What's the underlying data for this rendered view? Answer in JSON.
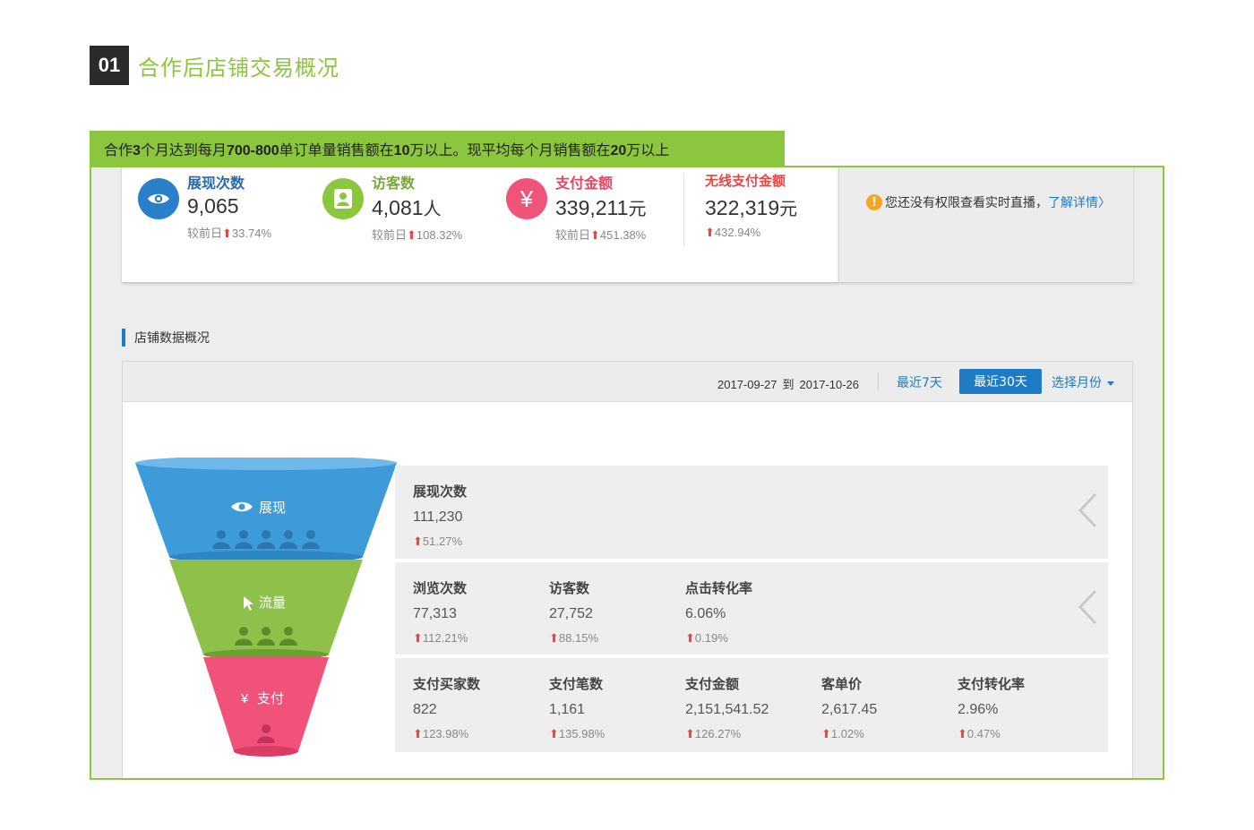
{
  "section": {
    "number": "01",
    "title": "合作后店铺交易概况"
  },
  "banner": {
    "parts": [
      {
        "text": "合作",
        "bold": false
      },
      {
        "text": "3",
        "bold": true
      },
      {
        "text": "个月达到每月",
        "bold": false
      },
      {
        "text": "700-800",
        "bold": true
      },
      {
        "text": "单订单量销售额在",
        "bold": false
      },
      {
        "text": "10",
        "bold": true
      },
      {
        "text": "万以上。现平均每个月销售额在",
        "bold": false
      },
      {
        "text": "20",
        "bold": true
      },
      {
        "text": "万以上",
        "bold": false
      }
    ]
  },
  "colors": {
    "accent_green": "#8cc63f",
    "brand_blue": "#1f7bc4",
    "up_red": "#e84545",
    "visitor_green": "#8cc63f",
    "payment_pink": "#f0547a"
  },
  "stats": [
    {
      "label": "展现次数",
      "value": "9,065",
      "unit": "",
      "compare": "较前日",
      "arrow": "⬆",
      "pct": "33.74%",
      "icon": "eye-icon",
      "color": "#2a7fc9"
    },
    {
      "label": "访客数",
      "value": "4,081",
      "unit": "人",
      "compare": "较前日",
      "arrow": "⬆",
      "pct": "108.32%",
      "icon": "user-icon",
      "color": "#8cc63f"
    },
    {
      "label": "支付金额",
      "value": "339,211",
      "unit": "元",
      "compare": "较前日",
      "arrow": "⬆",
      "pct": "451.38%",
      "icon": "yen-icon",
      "color": "#f0547a"
    },
    {
      "label": "无线支付金额",
      "value": "322,319",
      "unit": "元",
      "compare": "",
      "arrow": "⬆",
      "pct": "432.94%",
      "icon": "",
      "color": "#e84545"
    }
  ],
  "notice": {
    "icon": "!",
    "text": "您还没有权限查看实时直播，",
    "link": "了解详情"
  },
  "overview": {
    "title": "店铺数据概况",
    "date_from": "2017-09-27",
    "date_sep": "到",
    "date_to": "2017-10-26",
    "btn_7": "最近7天",
    "btn_30": "最近30天",
    "btn_month": "选择月份"
  },
  "funnel": {
    "stages": [
      {
        "label": "展现",
        "icon": "eye-icon",
        "color": "#3d9bd9",
        "people": 5
      },
      {
        "label": "流量",
        "icon": "cursor-icon",
        "color": "#8fc04a",
        "people": 3
      },
      {
        "label": "支付",
        "icon": "yen-icon",
        "color": "#f0527c",
        "people": 1
      }
    ]
  },
  "rows": [
    {
      "metrics": [
        {
          "label": "展现次数",
          "value": "111,230",
          "arrow": "⬆",
          "pct": "51.27%"
        }
      ]
    },
    {
      "metrics": [
        {
          "label": "浏览次数",
          "value": "77,313",
          "arrow": "⬆",
          "pct": "112.21%"
        },
        {
          "label": "访客数",
          "value": "27,752",
          "arrow": "⬆",
          "pct": "88.15%"
        },
        {
          "label": "点击转化率",
          "value": "6.06%",
          "arrow": "⬆",
          "pct": "0.19%"
        }
      ]
    },
    {
      "metrics": [
        {
          "label": "支付买家数",
          "value": "822",
          "arrow": "⬆",
          "pct": "123.98%"
        },
        {
          "label": "支付笔数",
          "value": "1,161",
          "arrow": "⬆",
          "pct": "135.98%"
        },
        {
          "label": "支付金额",
          "value": "2,151,541.52",
          "arrow": "⬆",
          "pct": "126.27%"
        },
        {
          "label": "客单价",
          "value": "2,617.45",
          "arrow": "⬆",
          "pct": "1.02%"
        },
        {
          "label": "支付转化率",
          "value": "2.96%",
          "arrow": "⬆",
          "pct": "0.47%"
        }
      ]
    }
  ]
}
